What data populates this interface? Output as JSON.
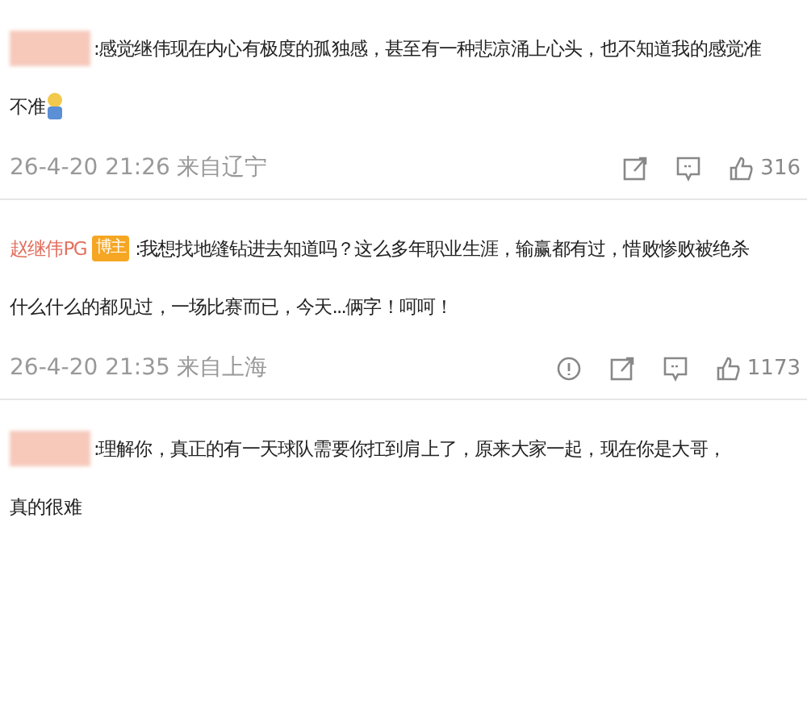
{
  "comments": [
    {
      "author": {
        "kind": "redacted"
      },
      "lines": [
        ":感觉继伟现在内心有极度的孤独感，甚至有一种悲凉涌上心头，也不知道我的感觉准",
        "不准"
      ],
      "emoji": true,
      "time": "26-4-20 21:26",
      "location": "来自辽宁",
      "actions": [
        {
          "kind": "share"
        },
        {
          "kind": "comment"
        },
        {
          "kind": "like",
          "count": "316"
        }
      ]
    },
    {
      "author": {
        "kind": "named",
        "name": "赵继伟PG",
        "badge": "博主"
      },
      "lines": [
        ":我想找地缝钻进去知道吗？这么多年职业生涯，输赢都有过，惜败惨败被绝杀",
        "什么什么的都见过，一场比赛而已，今天...俩字！呵呵！"
      ],
      "time": "26-4-20 21:35",
      "location": "来自上海",
      "actions": [
        {
          "kind": "report"
        },
        {
          "kind": "share"
        },
        {
          "kind": "comment"
        },
        {
          "kind": "like",
          "count": "1173"
        }
      ]
    },
    {
      "author": {
        "kind": "redacted"
      },
      "lines": [
        ":理解你，真正的有一天球队需要你扛到肩上了，原来大家一起，现在你是大哥，",
        "真的很难"
      ]
    }
  ]
}
